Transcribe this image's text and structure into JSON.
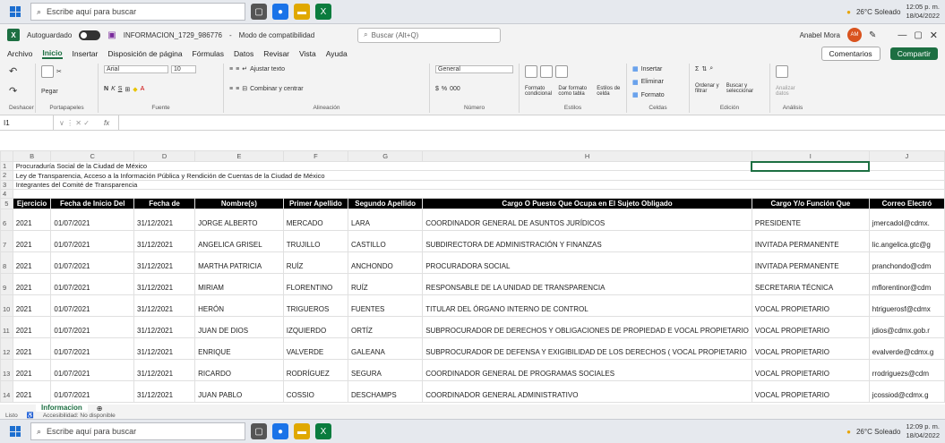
{
  "taskbar_top": {
    "search_placeholder": "Escribe aquí para buscar",
    "weather": "26°C Soleado",
    "time": "12:05 p. m.",
    "date": "18/04/2022"
  },
  "titlebar": {
    "autosave": "Autoguardado",
    "filename": "INFORMACION_1729_986776",
    "mode": "Modo de compatibilidad",
    "search_placeholder": "Buscar (Alt+Q)",
    "user": "Anabel Mora",
    "avatar": "AM"
  },
  "menu": {
    "items": [
      "Archivo",
      "Inicio",
      "Insertar",
      "Disposición de página",
      "Fórmulas",
      "Datos",
      "Revisar",
      "Vista",
      "Ayuda"
    ],
    "comments": "Comentarios",
    "share": "Compartir"
  },
  "ribbon": {
    "undo": "Deshacer",
    "clipboard": {
      "paste": "Pegar",
      "label": "Portapapeles"
    },
    "font": {
      "name": "Arial",
      "size": "10",
      "label": "Fuente"
    },
    "align": {
      "wrap": "Ajustar texto",
      "merge": "Combinar y centrar",
      "label": "Alineación"
    },
    "number": {
      "format": "General",
      "label": "Número"
    },
    "styles": {
      "cond": "Formato condicional",
      "table": "Dar formato como tabla",
      "cell": "Estilos de celda",
      "label": "Estilos"
    },
    "cells": {
      "insert": "Insertar",
      "delete": "Eliminar",
      "format": "Formato",
      "label": "Celdas"
    },
    "edit": {
      "sort": "Ordenar y filtrar",
      "find": "Buscar y seleccionar",
      "label": "Edición"
    },
    "analysis": {
      "btn": "Analizar datos",
      "label": "Análisis"
    }
  },
  "formula": {
    "cell": "I1",
    "fx": "fx"
  },
  "columns": [
    "B",
    "C",
    "D",
    "E",
    "F",
    "G",
    "H",
    "I",
    "J"
  ],
  "info_rows": [
    "Procuraduría Social de la Ciudad de México",
    "Ley de Transparencia, Acceso a la Información Pública y Rendición de Cuentas de la Ciudad de México",
    "Integrantes del Comité de Transparencia"
  ],
  "headers": [
    "Ejercicio",
    "Fecha de Inicio Del",
    "Fecha de",
    "Nombre(s)",
    "Primer Apellido",
    "Segundo Apellido",
    "Cargo O Puesto Que Ocupa en El Sujeto Obligado",
    "Cargo Y/o Función Que",
    "Correo Electró"
  ],
  "rows": [
    [
      "6",
      "2021",
      "01/07/2021",
      "31/12/2021",
      "JORGE ALBERTO",
      "MERCADO",
      "LARA",
      "COORDINADOR GENERAL DE ASUNTOS JURÍDICOS",
      "PRESIDENTE",
      "jmercadol@cdmx."
    ],
    [
      "7",
      "2021",
      "01/07/2021",
      "31/12/2021",
      "ANGELICA GRISEL",
      "TRUJILLO",
      "CASTILLO",
      "SUBDIRECTORA DE ADMINISTRACIÓN Y FINANZAS",
      "INVITADA PERMANENTE",
      "lic.angelica.gtc@g"
    ],
    [
      "8",
      "2021",
      "01/07/2021",
      "31/12/2021",
      "MARTHA PATRICIA",
      "RUÍZ",
      "ANCHONDO",
      "PROCURADORA SOCIAL",
      "INVITADA PERMANENTE",
      "pranchondo@cdm"
    ],
    [
      "9",
      "2021",
      "01/07/2021",
      "31/12/2021",
      "MIRIAM",
      "FLORENTINO",
      "RUÍZ",
      "RESPONSABLE DE LA UNIDAD DE TRANSPARENCIA",
      "SECRETARIA TÉCNICA",
      "mflorentinor@cdm"
    ],
    [
      "10",
      "2021",
      "01/07/2021",
      "31/12/2021",
      "HERÓN",
      "TRIGUEROS",
      "FUENTES",
      "TITULAR DEL ÓRGANO INTERNO DE CONTROL",
      "VOCAL PROPIETARIO",
      "htriguerosf@cdmx"
    ],
    [
      "11",
      "2021",
      "01/07/2021",
      "31/12/2021",
      "JUAN DE DIOS",
      "IZQUIERDO",
      "ORTÍZ",
      "SUBPROCURADOR DE DERECHOS Y OBLIGACIONES DE PROPIEDAD E VOCAL PROPIETARIO",
      "VOCAL PROPIETARIO",
      "jdios@cdmx.gob.r"
    ],
    [
      "12",
      "2021",
      "01/07/2021",
      "31/12/2021",
      "ENRIQUE",
      "VALVERDE",
      "GALEANA",
      "SUBPROCURADOR DE DEFENSA Y EXIGIBILIDAD DE LOS DERECHOS ( VOCAL PROPIETARIO",
      "VOCAL PROPIETARIO",
      "evalverde@cdmx.g"
    ],
    [
      "13",
      "2021",
      "01/07/2021",
      "31/12/2021",
      "RICARDO",
      "RODRÍGUEZ",
      "SEGURA",
      "COORDINADOR GENERAL DE PROGRAMAS SOCIALES",
      "VOCAL PROPIETARIO",
      "rrodriguezs@cdm"
    ],
    [
      "14",
      "2021",
      "01/07/2021",
      "31/12/2021",
      "JUAN PABLO",
      "COSSIO",
      "DESCHAMPS",
      "COORDINADOR GENERAL ADMINISTRATIVO",
      "VOCAL PROPIETARIO",
      "jcossiod@cdmx.g"
    ]
  ],
  "sheet_tab": "Informacion",
  "status": {
    "ready": "Listo",
    "accessibility": "Accesibilidad: No disponible"
  },
  "taskbar_bottom": {
    "search_placeholder": "Escribe aquí para buscar",
    "weather": "26°C Soleado",
    "time": "12:09 p. m.",
    "date": "18/04/2022"
  }
}
